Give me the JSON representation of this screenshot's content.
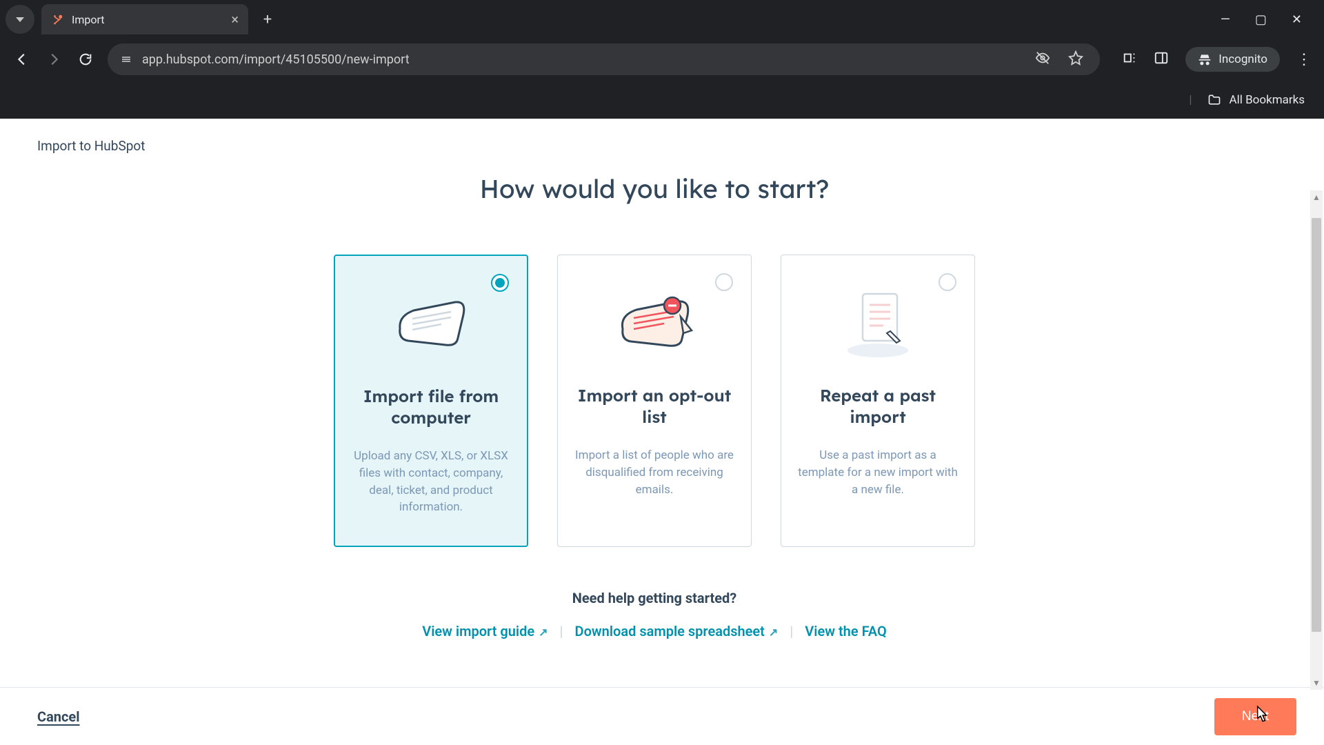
{
  "browser": {
    "tab_title": "Import",
    "url": "app.hubspot.com/import/45105500/new-import",
    "incognito_label": "Incognito",
    "all_bookmarks": "All Bookmarks"
  },
  "breadcrumb": "Import to HubSpot",
  "page_title": "How would you like to start?",
  "cards": [
    {
      "key": "file",
      "title": "Import file from computer",
      "desc": "Upload any CSV, XLS, or XLSX files with contact, company, deal, ticket, and product information.",
      "selected": true
    },
    {
      "key": "optout",
      "title": "Import an opt-out list",
      "desc": "Import a list of people who are disqualified from receiving emails.",
      "selected": false
    },
    {
      "key": "repeat",
      "title": "Repeat a past import",
      "desc": "Use a past import as a template for a new import with a new file.",
      "selected": false
    }
  ],
  "help": {
    "heading": "Need help getting started?",
    "links": {
      "guide": "View import guide",
      "sample": "Download sample spreadsheet",
      "faq": "View the FAQ"
    }
  },
  "footer": {
    "cancel": "Cancel",
    "next": "Next"
  },
  "colors": {
    "accent": "#00a4bd",
    "primary_btn": "#ff7a59",
    "link": "#0091ae"
  }
}
